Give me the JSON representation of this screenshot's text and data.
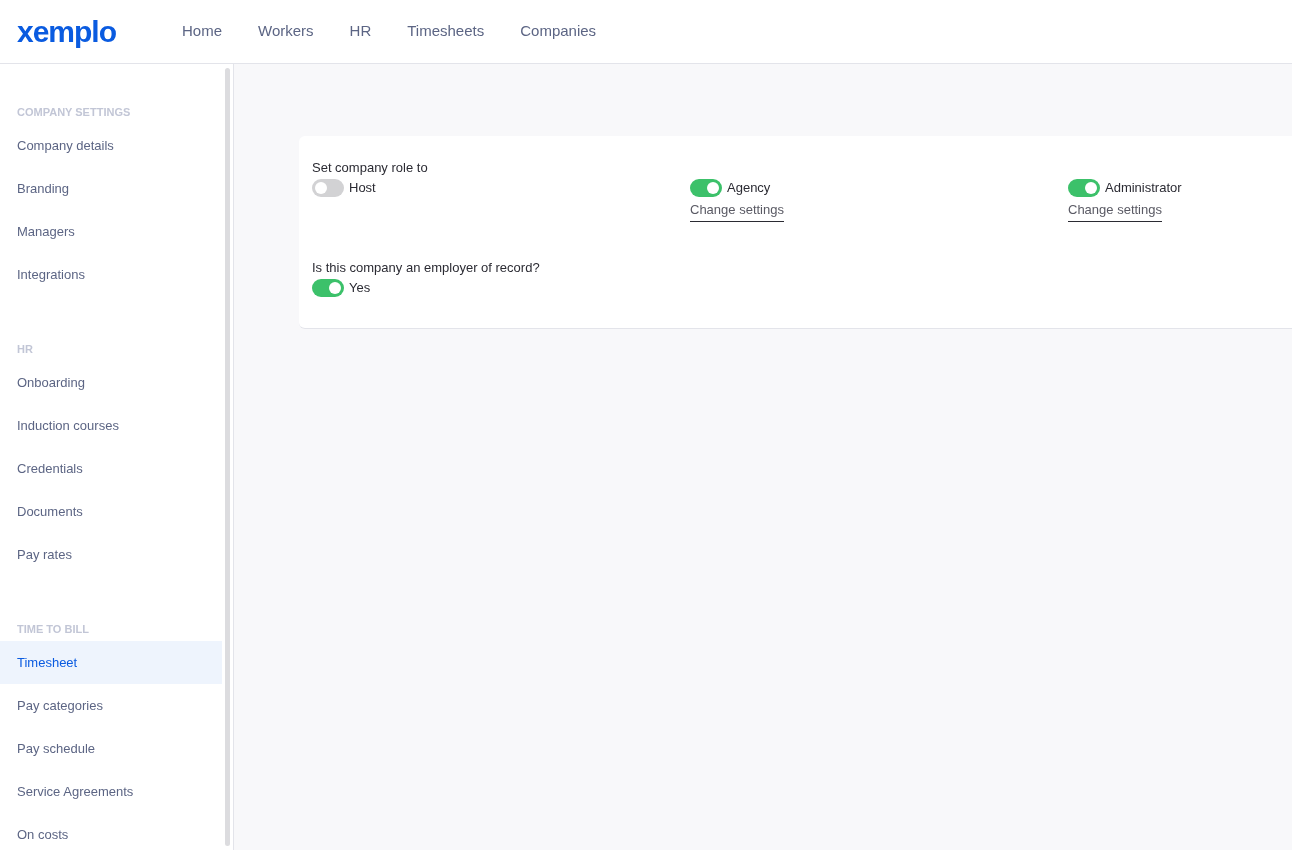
{
  "logo": "xemplo",
  "nav": [
    {
      "label": "Home"
    },
    {
      "label": "Workers"
    },
    {
      "label": "HR"
    },
    {
      "label": "Timesheets"
    },
    {
      "label": "Companies"
    }
  ],
  "sidebar": {
    "sections": [
      {
        "heading": "COMPANY SETTINGS",
        "items": [
          {
            "label": "Company details",
            "selected": false
          },
          {
            "label": "Branding",
            "selected": false
          },
          {
            "label": "Managers",
            "selected": false
          },
          {
            "label": "Integrations",
            "selected": false
          }
        ]
      },
      {
        "heading": "HR",
        "items": [
          {
            "label": "Onboarding",
            "selected": false
          },
          {
            "label": "Induction courses",
            "selected": false
          },
          {
            "label": "Credentials",
            "selected": false
          },
          {
            "label": "Documents",
            "selected": false
          },
          {
            "label": "Pay rates",
            "selected": false
          }
        ]
      },
      {
        "heading": "TIME TO BILL",
        "items": [
          {
            "label": "Timesheet",
            "selected": true
          },
          {
            "label": "Pay categories",
            "selected": false
          },
          {
            "label": "Pay schedule",
            "selected": false
          },
          {
            "label": "Service Agreements",
            "selected": false
          },
          {
            "label": "On costs",
            "selected": false
          }
        ]
      }
    ]
  },
  "card": {
    "role_label": "Set company role to",
    "roles": [
      {
        "label": "Host",
        "on": false
      },
      {
        "label": "Agency",
        "on": true,
        "link": "Change settings"
      },
      {
        "label": "Administrator",
        "on": true,
        "link": "Change settings"
      }
    ],
    "eor_label": "Is this company an employer of record?",
    "eor": {
      "label": "Yes",
      "on": true
    }
  }
}
